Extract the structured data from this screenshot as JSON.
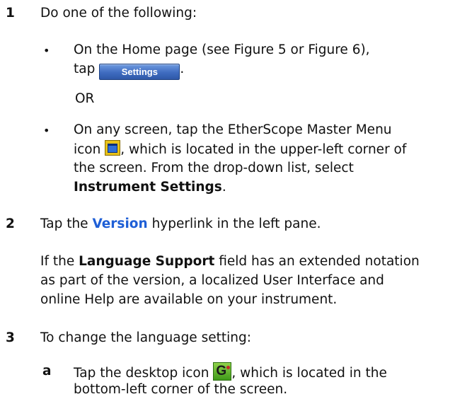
{
  "steps": [
    {
      "number": "1",
      "text": "Do one of the following:",
      "options": [
        {
          "line1": "On the Home page (see Figure 5 or Figure 6),",
          "line2_pre": "tap",
          "button_label": "Settings",
          "line2_post": "."
        },
        {
          "line1": "On any screen, tap the EtherScope Master Menu",
          "line2_pre": "icon",
          "line2_post": ", which is located in the upper-left corner of",
          "line3": "the screen. From the drop-down list, select",
          "line4_bold": "Instrument Settings",
          "line4_post": "."
        }
      ],
      "or_text": "OR"
    },
    {
      "number": "2",
      "pre": "Tap the",
      "link": "Version",
      "post": "hyperlink in the left pane.",
      "note_pre": "If the",
      "note_bold": "Language Support",
      "note_line1_post": "field has an extended notation",
      "note_line2": "as part of the version, a localized User Interface and",
      "note_line3": "online Help are available on your instrument."
    },
    {
      "number": "3",
      "text": "To change the language setting:",
      "substeps": [
        {
          "letter": "a",
          "line1_pre": "Tap the desktop icon",
          "line1_post": ", which is located in the",
          "line2": "bottom-left corner of the screen."
        }
      ]
    }
  ],
  "bullet_char": "•"
}
